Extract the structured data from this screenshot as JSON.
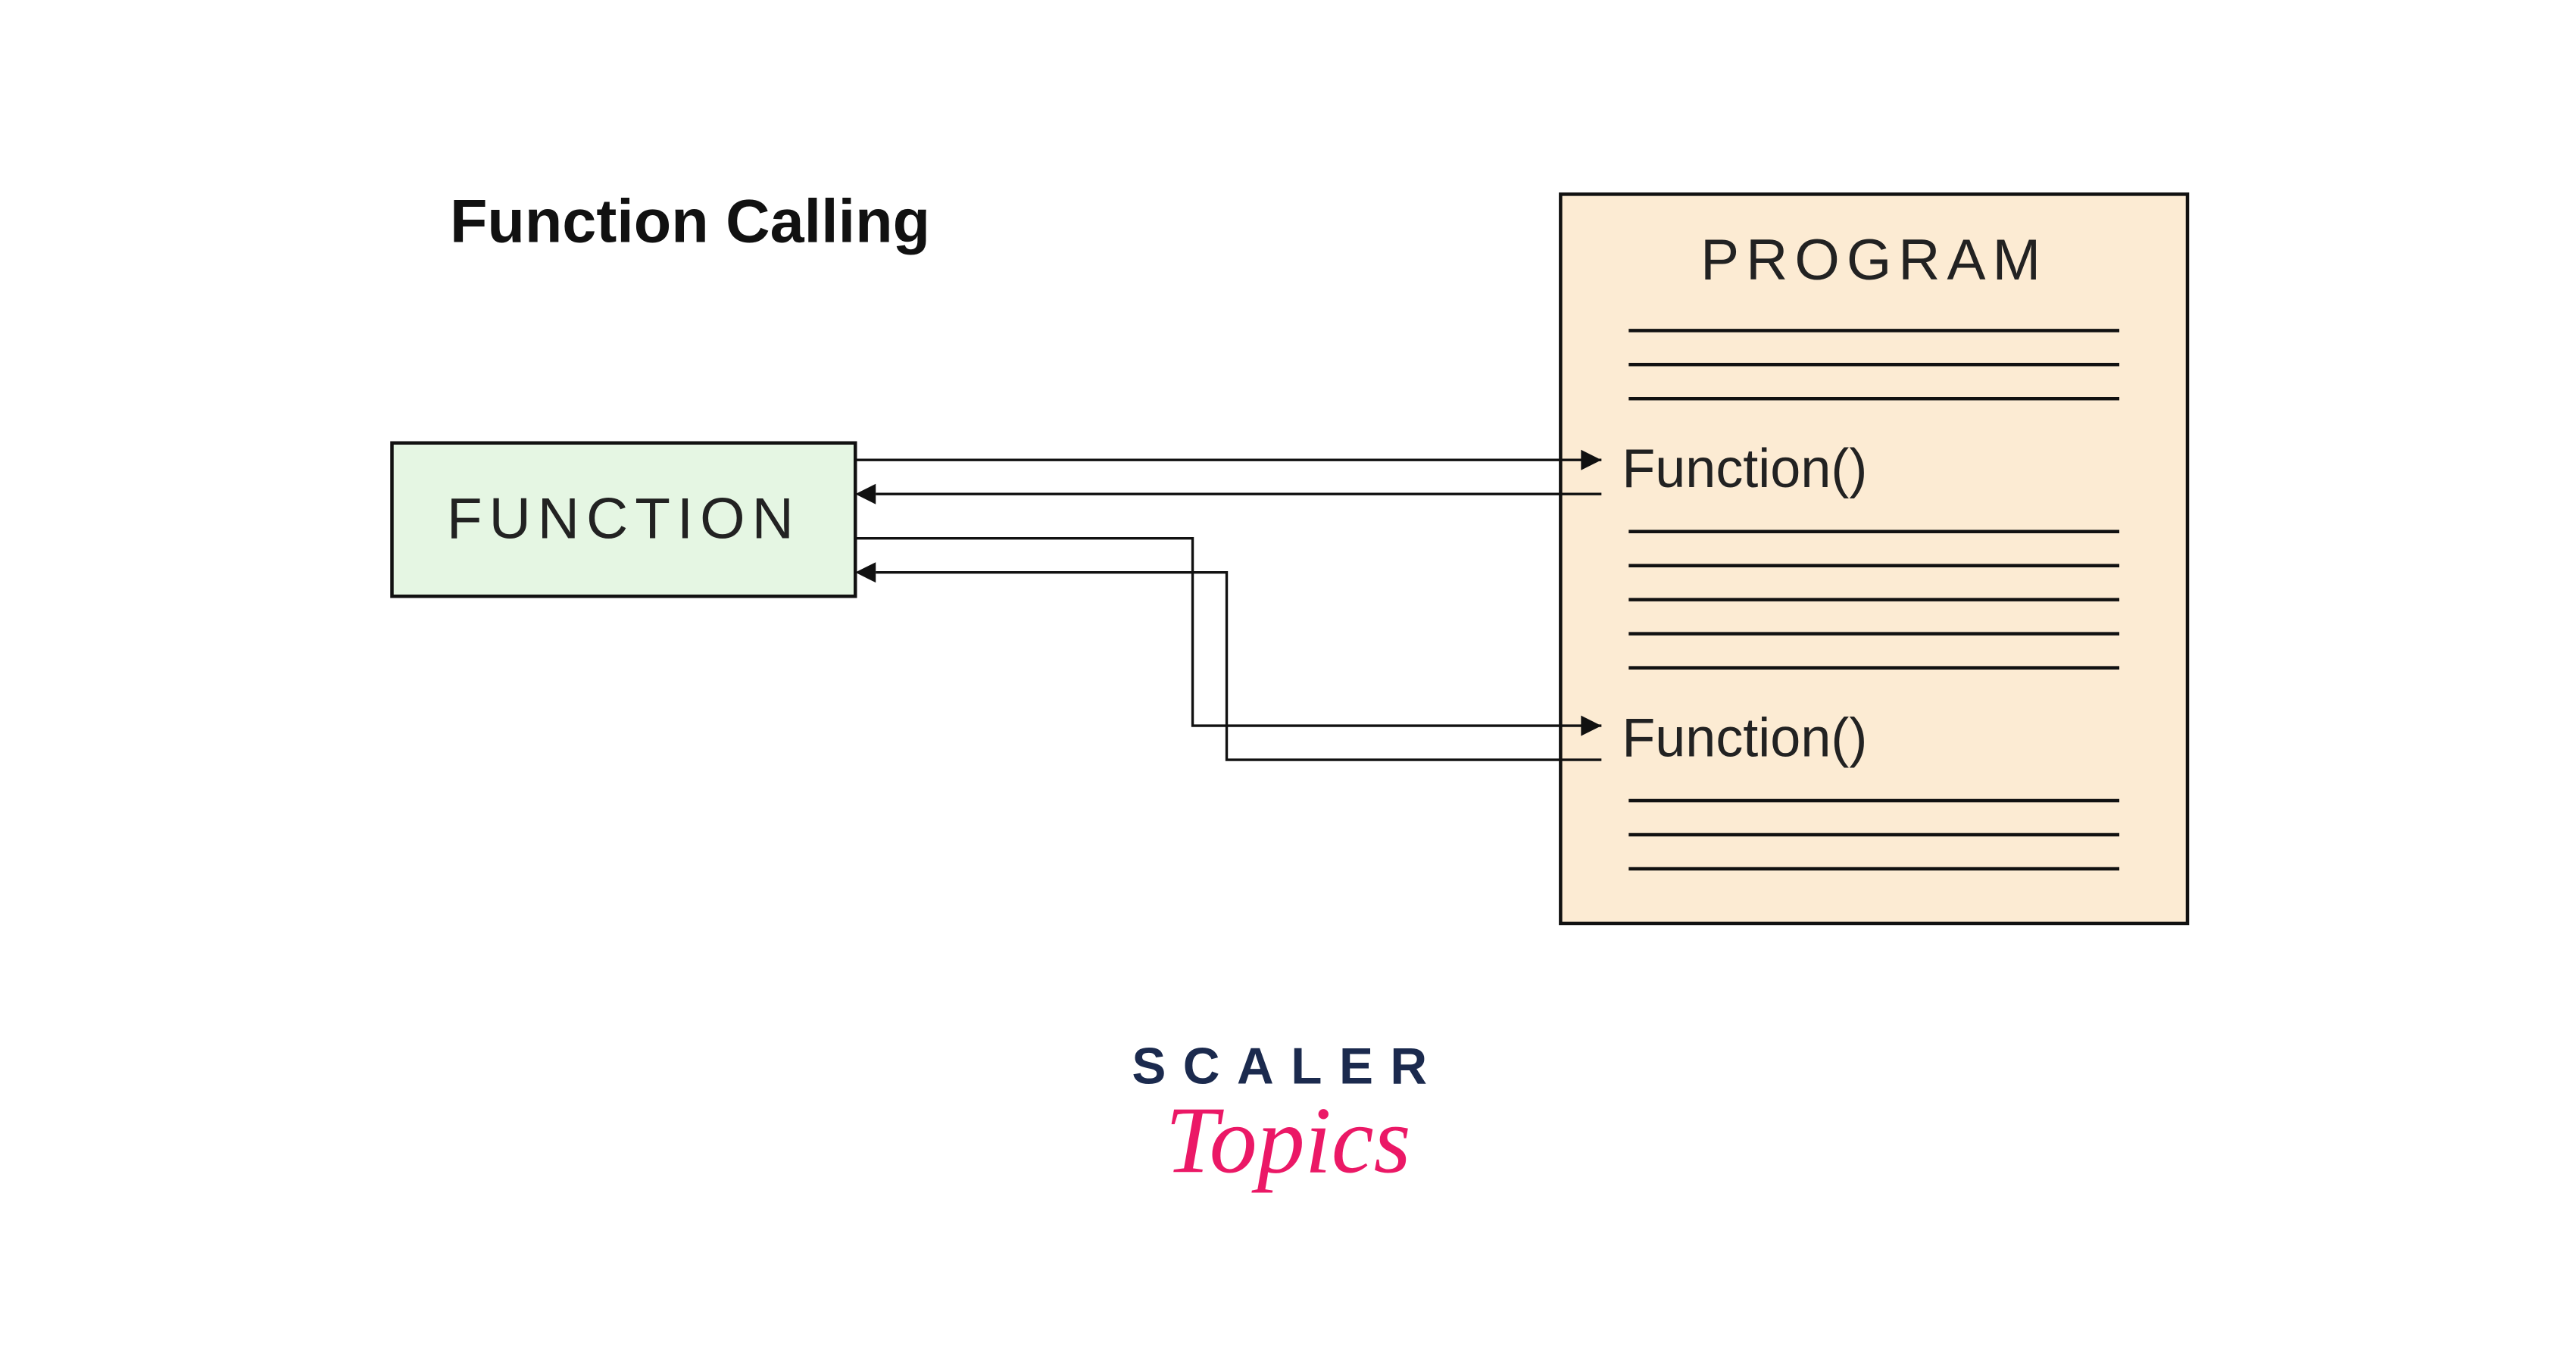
{
  "title": "Function Calling",
  "function_box_label": "FUNCTION",
  "program_box_label": "PROGRAM",
  "call_label_1": "Function()",
  "call_label_2": "Function()",
  "brand_primary": "SCALER",
  "brand_secondary": "Topics",
  "colors": {
    "function_fill": "#e5f6e3",
    "program_fill": "#fcebd3",
    "stroke": "#111111",
    "brand_primary": "#1b2a4e",
    "brand_secondary": "#eb1866"
  }
}
